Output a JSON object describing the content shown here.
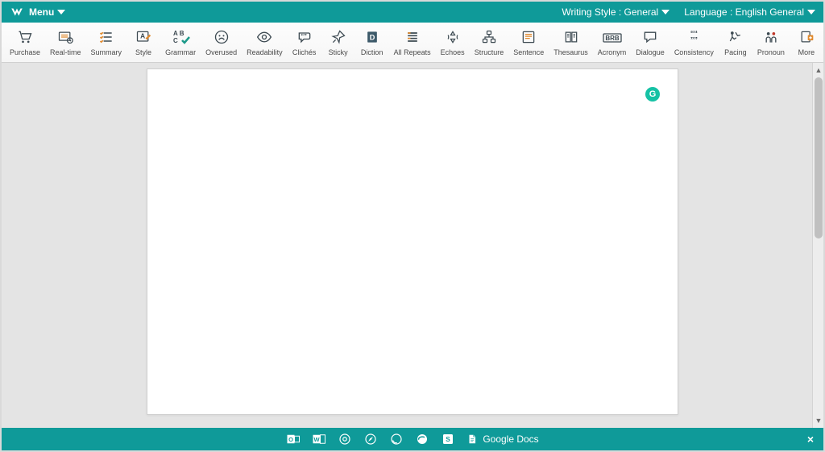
{
  "topbar": {
    "menu_label": "Menu",
    "writing_style_label": "Writing Style : General",
    "language_label": "Language : English General"
  },
  "toolbar": {
    "items": [
      {
        "id": "purchase",
        "label": "Purchase"
      },
      {
        "id": "realtime",
        "label": "Real-time"
      },
      {
        "id": "summary",
        "label": "Summary"
      },
      {
        "id": "style",
        "label": "Style"
      },
      {
        "id": "grammar",
        "label": "Grammar"
      },
      {
        "id": "overused",
        "label": "Overused"
      },
      {
        "id": "readability",
        "label": "Readability"
      },
      {
        "id": "cliches",
        "label": "Clichés"
      },
      {
        "id": "sticky",
        "label": "Sticky"
      },
      {
        "id": "diction",
        "label": "Diction"
      },
      {
        "id": "allrepeats",
        "label": "All Repeats"
      },
      {
        "id": "echoes",
        "label": "Echoes"
      },
      {
        "id": "structure",
        "label": "Structure"
      },
      {
        "id": "sentence",
        "label": "Sentence"
      },
      {
        "id": "thesaurus",
        "label": "Thesaurus"
      },
      {
        "id": "acronym",
        "label": "Acronym"
      },
      {
        "id": "dialogue",
        "label": "Dialogue"
      },
      {
        "id": "consistency",
        "label": "Consistency"
      },
      {
        "id": "pacing",
        "label": "Pacing"
      },
      {
        "id": "pronoun",
        "label": "Pronoun"
      },
      {
        "id": "more",
        "label": "More"
      }
    ]
  },
  "document": {
    "body_text": "",
    "extension_badge": "G"
  },
  "bottombar": {
    "google_docs_label": "Google Docs",
    "close_label": "×"
  }
}
